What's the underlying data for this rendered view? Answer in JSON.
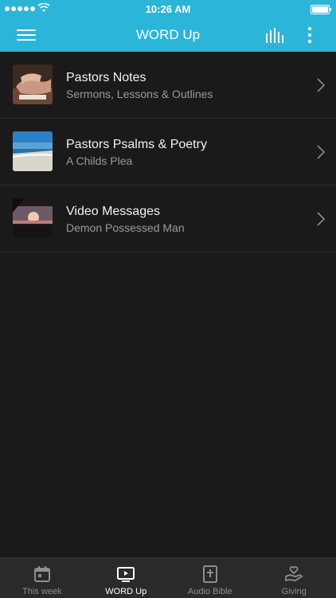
{
  "status": {
    "time": "10:26 AM"
  },
  "nav": {
    "title": "WORD Up"
  },
  "items": [
    {
      "title": "Pastors Notes",
      "subtitle": "Sermons, Lessons & Outlines"
    },
    {
      "title": "Pastors Psalms & Poetry",
      "subtitle": "A Childs Plea"
    },
    {
      "title": "Video Messages",
      "subtitle": "Demon Possessed Man"
    }
  ],
  "tabs": [
    {
      "label": "This week",
      "icon": "calendar-icon"
    },
    {
      "label": "WORD Up",
      "icon": "video-icon"
    },
    {
      "label": "Audio Bible",
      "icon": "bible-icon"
    },
    {
      "label": "Giving",
      "icon": "giving-icon"
    }
  ],
  "colors": {
    "accent": "#2bb5d9",
    "background": "#1a1a1b",
    "tabbar": "#2a2a2c"
  }
}
